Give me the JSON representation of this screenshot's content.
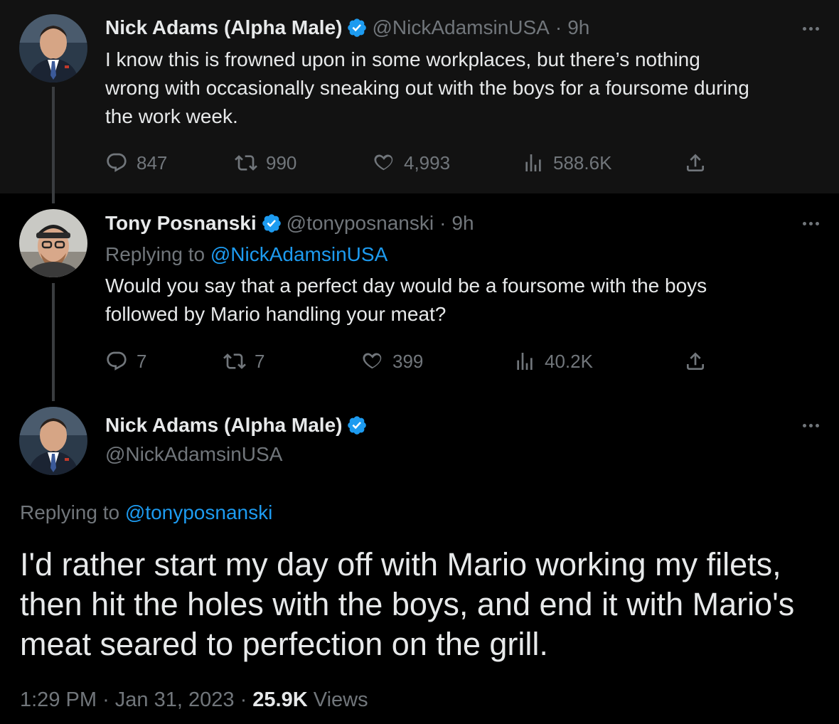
{
  "tweet1": {
    "display_name": "Nick Adams (Alpha Male)",
    "handle": "@NickAdamsinUSA",
    "separator": "·",
    "time": "9h",
    "lines": [
      "I know this is frowned upon in some workplaces, but there’s nothing",
      "wrong with occasionally sneaking out with the boys for a foursome during",
      "the work week."
    ],
    "replies": "847",
    "retweets": "990",
    "likes": "4,993",
    "views": "588.6K"
  },
  "tweet2": {
    "display_name": "Tony Posnanski",
    "handle": "@tonyposnanski",
    "separator": "·",
    "time": "9h",
    "replying_label": "Replying to",
    "replying_handle": "@NickAdamsinUSA",
    "lines": [
      "Would you say that a perfect day would be a foursome with the boys",
      "followed by Mario handling your meat?"
    ],
    "replies": "7",
    "retweets": "7",
    "likes": "399",
    "views": "40.2K"
  },
  "tweet3": {
    "display_name": "Nick Adams (Alpha Male)",
    "handle": "@NickAdamsinUSA",
    "replying_label": "Replying to",
    "replying_handle": "@tonyposnanski",
    "text": "I'd rather start my day off with Mario working my filets, then hit the holes with the boys, and end it with Mario's meat seared to perfection on the grill.",
    "time": "1:29 PM",
    "separator": "·",
    "date": "Jan 31, 2023",
    "views_count": "25.9K",
    "views_label": "Views"
  },
  "colors": {
    "background": "#000000",
    "highlight_background": "#121212",
    "text": "#e7e9ea",
    "muted": "#71767b",
    "accent": "#1d9bf0"
  }
}
